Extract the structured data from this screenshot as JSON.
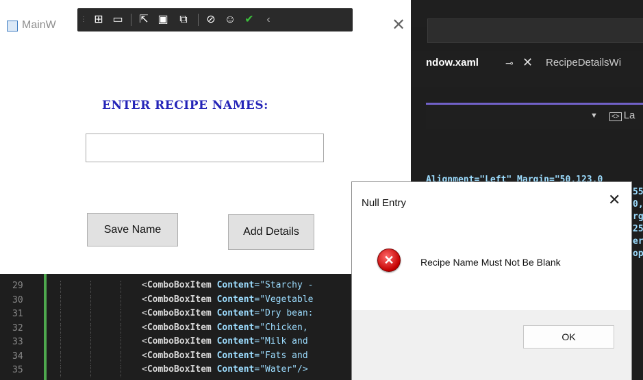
{
  "main_window": {
    "title": "MainW",
    "heading": "ENTER RECIPE NAMES:",
    "input_value": "",
    "save_button": "Save Name",
    "add_button": "Add Details"
  },
  "debug_toolbar": {
    "icons": [
      "select-element-icon",
      "video-icon",
      "cursor-icon",
      "frame-icon",
      "track-focus-icon",
      "binding-icon",
      "accessibility-icon",
      "check-icon",
      "chevron-left-icon"
    ]
  },
  "vs": {
    "active_tab": "ndow.xaml",
    "pin_glyph": "⊸",
    "close_glyph": "✕",
    "other_tab": "RecipeDetailsWi",
    "toolbar_label": "La",
    "partial_code": [
      {
        "text": "Alignment=\"Left\" Margin=\"50,123,0"
      },
      {
        "text": "55"
      },
      {
        "text": "0,"
      },
      {
        "text": "rg"
      },
      {
        "text": "25"
      },
      {
        "text": "er"
      },
      {
        "text": "op"
      }
    ],
    "lines": [
      {
        "num": "29",
        "tag": "ComboBoxItem",
        "attr": "Content",
        "val": "=\"Starchy -"
      },
      {
        "num": "30",
        "tag": "ComboBoxItem",
        "attr": "Content",
        "val": "=\"Vegetable"
      },
      {
        "num": "31",
        "tag": "ComboBoxItem",
        "attr": "Content",
        "val": "=\"Dry bean:"
      },
      {
        "num": "32",
        "tag": "ComboBoxItem",
        "attr": "Content",
        "val": "=\"Chicken,"
      },
      {
        "num": "33",
        "tag": "ComboBoxItem",
        "attr": "Content",
        "val": "=\"Milk and"
      },
      {
        "num": "34",
        "tag": "ComboBoxItem",
        "attr": "Content",
        "val": "=\"Fats and"
      },
      {
        "num": "35",
        "tag": "ComboBoxItem",
        "attr": "Content",
        "val": "=\"Water\"/>"
      }
    ]
  },
  "dialog": {
    "title": "Null Entry",
    "message": "Recipe Name Must Not Be Blank",
    "ok": "OK",
    "icon": "error-icon"
  },
  "colors": {
    "heading": "#2525b8",
    "accent": "#7161c8",
    "error": "#c40000"
  }
}
